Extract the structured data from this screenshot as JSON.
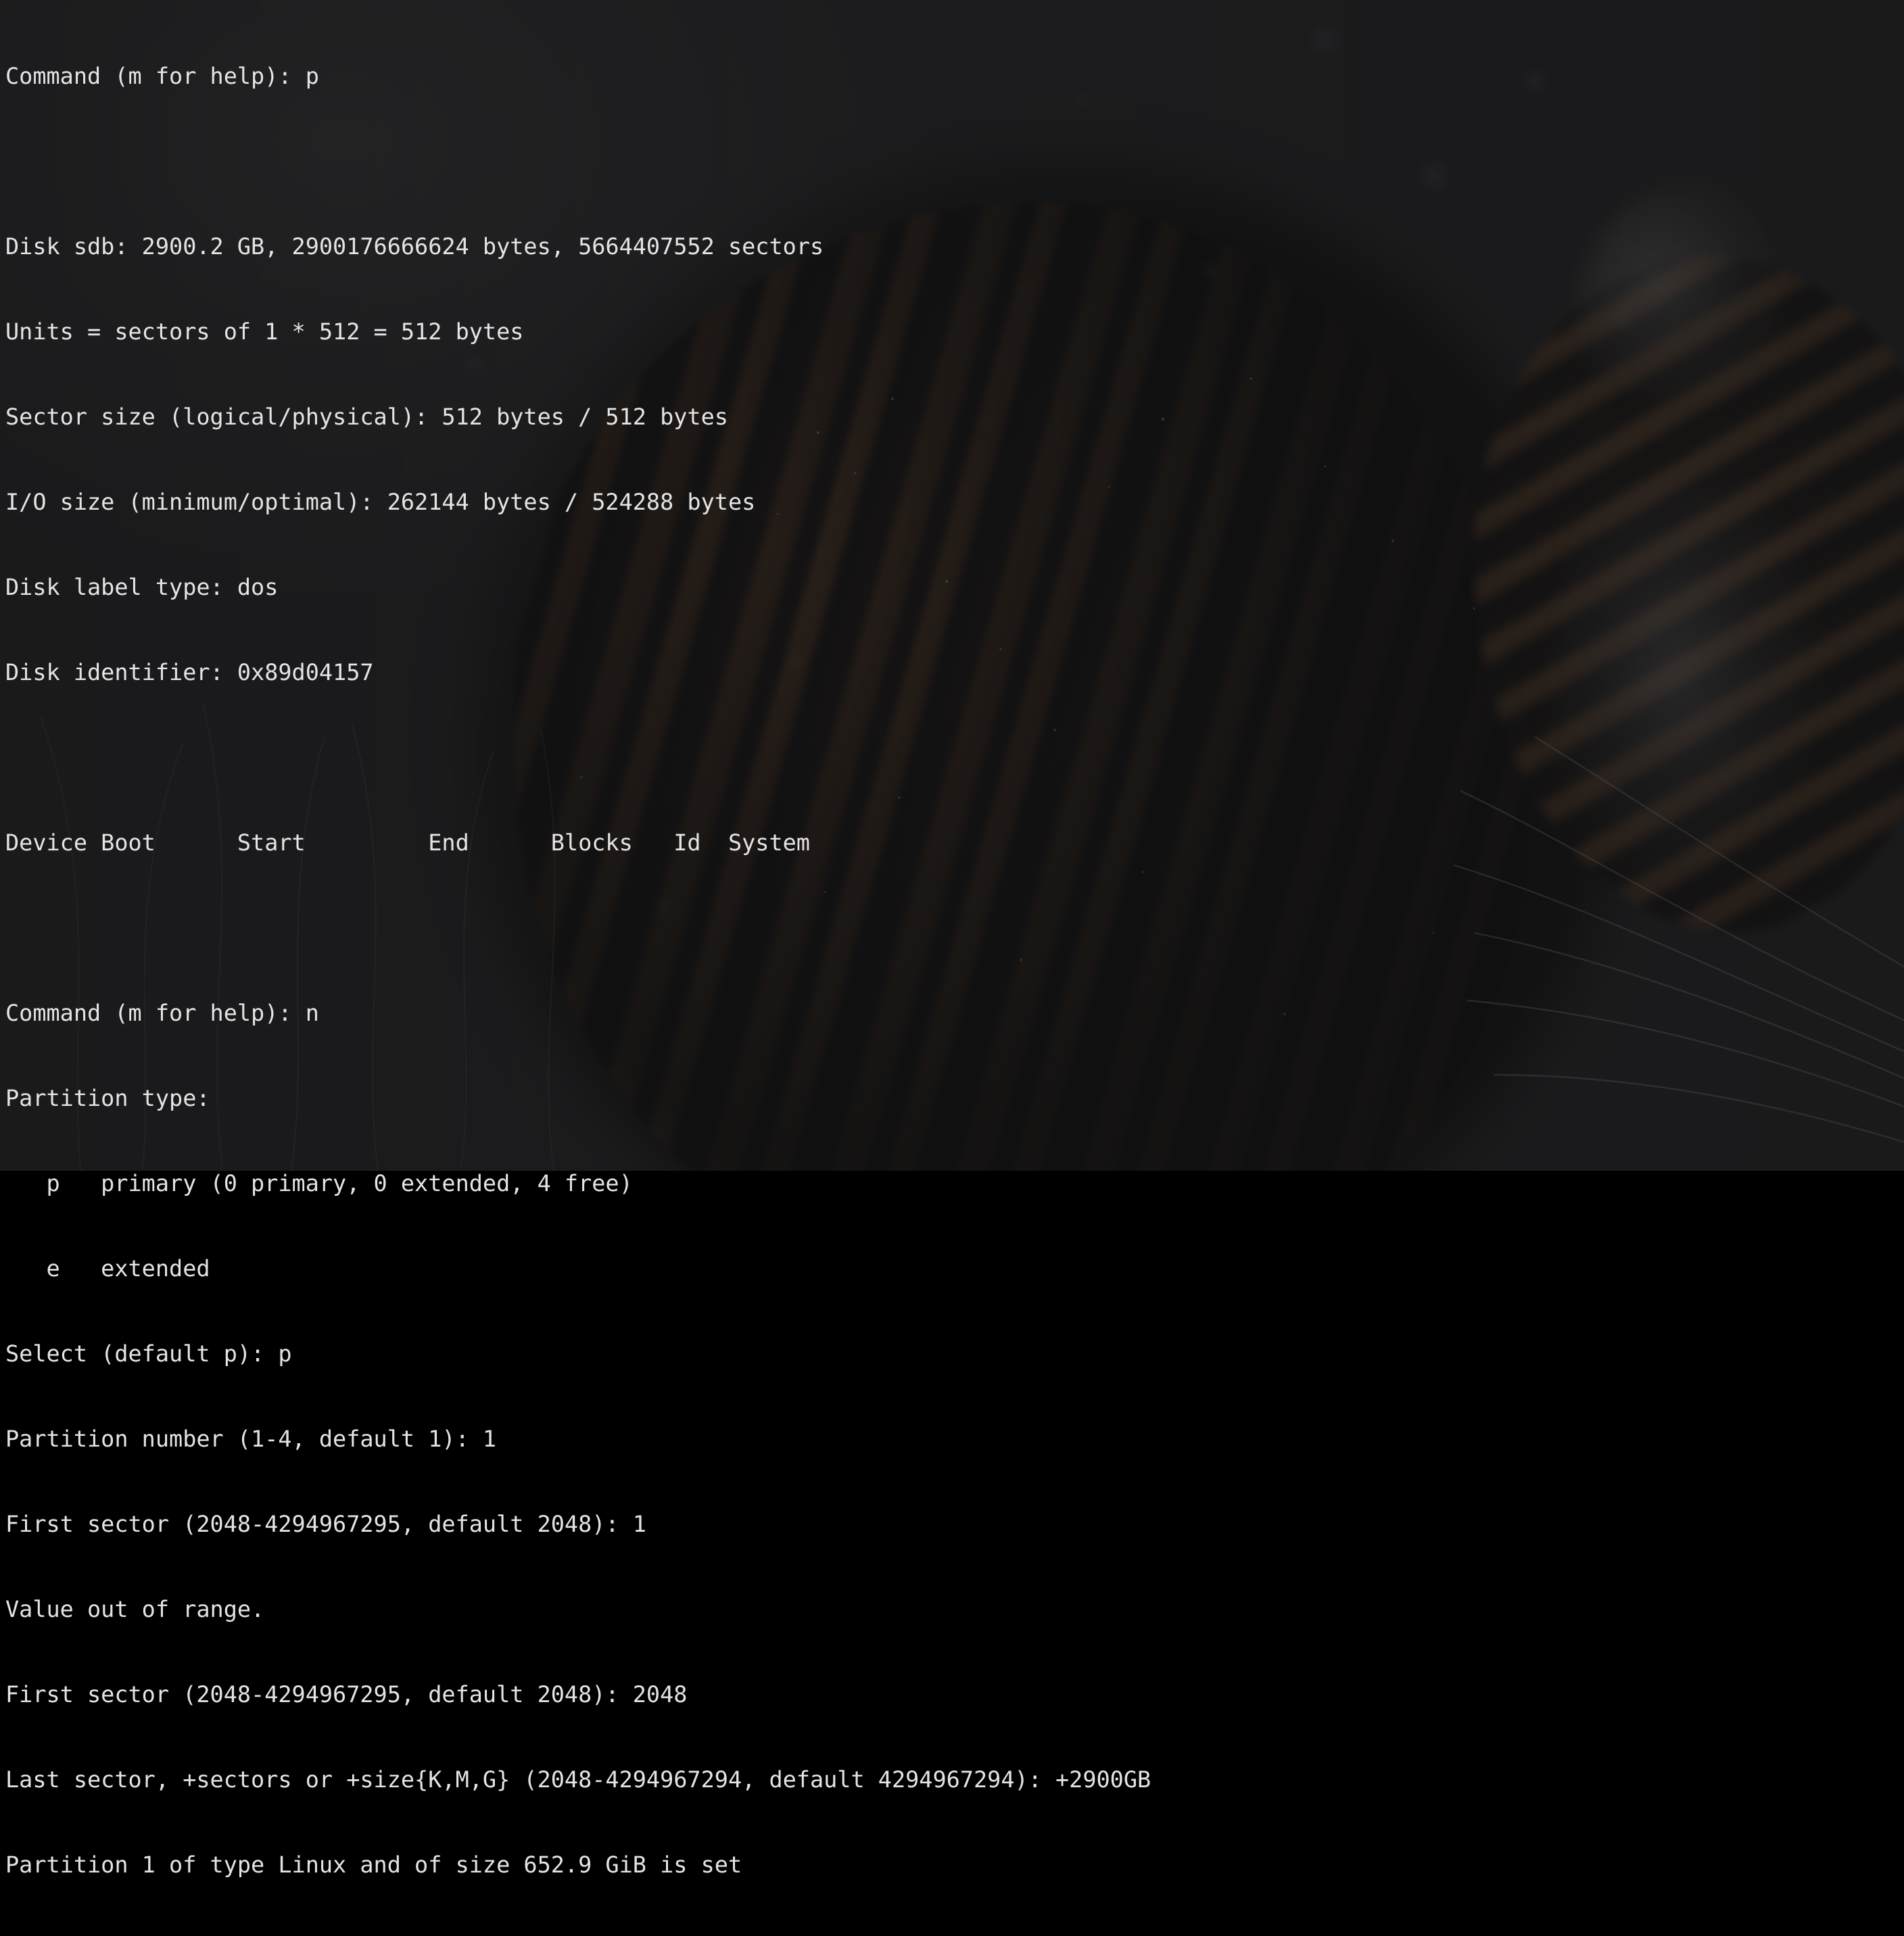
{
  "terminal": {
    "app": "fdisk",
    "colors": {
      "background": "#1c1c1e",
      "background_opacity": "0.58",
      "foreground": "#e4e4e4"
    },
    "wallpaper": {
      "subject": "tiger in snow",
      "tones": [
        "#2c2c2e",
        "#53331a",
        "#140c06",
        "#b0b2b4"
      ]
    },
    "lines": [
      {
        "id": "l01",
        "text": "Command (m for help): p"
      },
      {
        "id": "l02",
        "text": ""
      },
      {
        "id": "l03",
        "text": "Disk sdb: 2900.2 GB, 2900176666624 bytes, 5664407552 sectors"
      },
      {
        "id": "l04",
        "text": "Units = sectors of 1 * 512 = 512 bytes"
      },
      {
        "id": "l05",
        "text": "Sector size (logical/physical): 512 bytes / 512 bytes"
      },
      {
        "id": "l06",
        "text": "I/O size (minimum/optimal): 262144 bytes / 524288 bytes"
      },
      {
        "id": "l07",
        "text": "Disk label type: dos"
      },
      {
        "id": "l08",
        "text": "Disk identifier: 0x89d04157"
      },
      {
        "id": "l09",
        "text": ""
      },
      {
        "id": "l10",
        "text": "Device Boot      Start         End      Blocks   Id  System"
      },
      {
        "id": "l11",
        "text": ""
      },
      {
        "id": "l12",
        "text": "Command (m for help): n"
      },
      {
        "id": "l13",
        "text": "Partition type:"
      },
      {
        "id": "l14",
        "text": "   p   primary (0 primary, 0 extended, 4 free)"
      },
      {
        "id": "l15",
        "text": "   e   extended"
      },
      {
        "id": "l16",
        "text": "Select (default p): p"
      },
      {
        "id": "l17",
        "text": "Partition number (1-4, default 1): 1"
      },
      {
        "id": "l18",
        "text": "First sector (2048-4294967295, default 2048): 1"
      },
      {
        "id": "l19",
        "text": "Value out of range."
      },
      {
        "id": "l20",
        "text": "First sector (2048-4294967295, default 2048): 2048"
      },
      {
        "id": "l21",
        "text": "Last sector, +sectors or +size{K,M,G} (2048-4294967294, default 4294967294): +2900GB"
      },
      {
        "id": "l22",
        "text": "Partition 1 of type Linux and of size 652.9 GiB is set"
      }
    ],
    "disk": {
      "device": "sdb",
      "size_human": "2900.2 GB",
      "size_bytes": "2900176666624",
      "sectors": "5664407552",
      "units": "sectors of 1 * 512 = 512 bytes",
      "sector_size_logical": "512 bytes",
      "sector_size_physical": "512 bytes",
      "io_size_minimum": "262144 bytes",
      "io_size_optimal": "524288 bytes",
      "label_type": "dos",
      "identifier": "0x89d04157"
    },
    "partition_table": {
      "headers": [
        "Device Boot",
        "Start",
        "End",
        "Blocks",
        "Id",
        "System"
      ],
      "rows": []
    },
    "prompts": {
      "command_prompt": "Command (m for help): ",
      "commands_entered": [
        "p",
        "n"
      ],
      "partition_type_label": "Partition type:",
      "type_options": [
        {
          "key": "p",
          "label": "primary (0 primary, 0 extended, 4 free)"
        },
        {
          "key": "e",
          "label": "extended"
        }
      ],
      "select_prompt": "Select (default p): ",
      "select_value": "p",
      "partition_number_prompt": "Partition number (1-4, default 1): ",
      "partition_number_value": "1",
      "first_sector_prompt": "First sector (2048-4294967295, default 2048): ",
      "first_sector_attempt_1": "1",
      "error_message": "Value out of range.",
      "first_sector_attempt_2": "2048",
      "last_sector_prompt": "Last sector, +sectors or +size{K,M,G} (2048-4294967294, default 4294967294): ",
      "last_sector_value": "+2900GB",
      "result_message": "Partition 1 of type Linux and of size 652.9 GiB is set"
    }
  }
}
